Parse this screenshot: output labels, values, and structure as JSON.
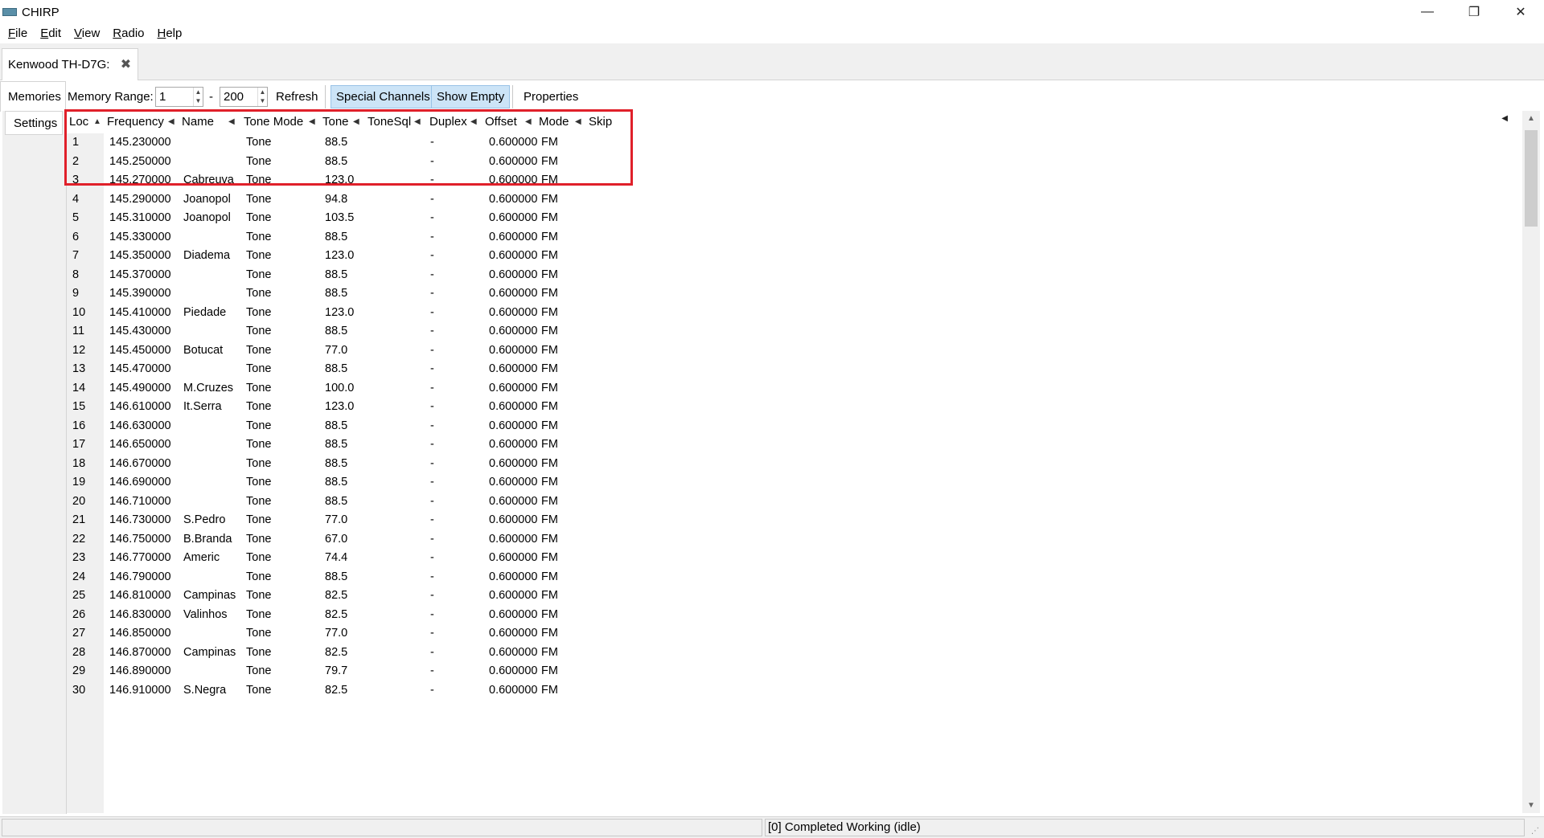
{
  "window": {
    "title": "CHIRP",
    "controls": [
      "—",
      "❐",
      "✕"
    ]
  },
  "menu": [
    {
      "label": "File",
      "accel": "F",
      "rest": "ile"
    },
    {
      "label": "Edit",
      "accel": "E",
      "rest": "dit"
    },
    {
      "label": "View",
      "accel": "V",
      "rest": "iew"
    },
    {
      "label": "Radio",
      "accel": "R",
      "rest": "adio"
    },
    {
      "label": "Help",
      "accel": "H",
      "rest": "elp"
    }
  ],
  "tab": {
    "label": "Kenwood TH-D7G:",
    "close_glyph": "✖"
  },
  "toolbar": {
    "memories": "Memories",
    "range_label": "Memory Range:",
    "range_start": "1",
    "range_dash": "-",
    "range_end": "200",
    "refresh": "Refresh",
    "special_channels": "Special Channels",
    "show_empty": "Show Empty",
    "properties": "Properties"
  },
  "settings_tab": "Settings",
  "columns": [
    "Loc",
    "Frequency",
    "Name",
    "Tone Mode",
    "Tone",
    "ToneSql",
    "Duplex",
    "Offset",
    "Mode",
    "Skip"
  ],
  "rows": [
    [
      "1",
      "145.230000",
      "",
      "Tone",
      "88.5",
      "",
      "-",
      "0.600000",
      "FM",
      ""
    ],
    [
      "2",
      "145.250000",
      "",
      "Tone",
      "88.5",
      "",
      "-",
      "0.600000",
      "FM",
      ""
    ],
    [
      "3",
      "145.270000",
      "Cabreuva",
      "Tone",
      "123.0",
      "",
      "-",
      "0.600000",
      "FM",
      ""
    ],
    [
      "4",
      "145.290000",
      "Joanopol",
      "Tone",
      "94.8",
      "",
      "-",
      "0.600000",
      "FM",
      ""
    ],
    [
      "5",
      "145.310000",
      "Joanopol",
      "Tone",
      "103.5",
      "",
      "-",
      "0.600000",
      "FM",
      ""
    ],
    [
      "6",
      "145.330000",
      "",
      "Tone",
      "88.5",
      "",
      "-",
      "0.600000",
      "FM",
      ""
    ],
    [
      "7",
      "145.350000",
      "Diadema",
      "Tone",
      "123.0",
      "",
      "-",
      "0.600000",
      "FM",
      ""
    ],
    [
      "8",
      "145.370000",
      "",
      "Tone",
      "88.5",
      "",
      "-",
      "0.600000",
      "FM",
      ""
    ],
    [
      "9",
      "145.390000",
      "",
      "Tone",
      "88.5",
      "",
      "-",
      "0.600000",
      "FM",
      ""
    ],
    [
      "10",
      "145.410000",
      "Piedade",
      "Tone",
      "123.0",
      "",
      "-",
      "0.600000",
      "FM",
      ""
    ],
    [
      "11",
      "145.430000",
      "",
      "Tone",
      "88.5",
      "",
      "-",
      "0.600000",
      "FM",
      ""
    ],
    [
      "12",
      "145.450000",
      "Botucat",
      "Tone",
      "77.0",
      "",
      "-",
      "0.600000",
      "FM",
      ""
    ],
    [
      "13",
      "145.470000",
      "",
      "Tone",
      "88.5",
      "",
      "-",
      "0.600000",
      "FM",
      ""
    ],
    [
      "14",
      "145.490000",
      "M.Cruzes",
      "Tone",
      "100.0",
      "",
      "-",
      "0.600000",
      "FM",
      ""
    ],
    [
      "15",
      "146.610000",
      "It.Serra",
      "Tone",
      "123.0",
      "",
      "-",
      "0.600000",
      "FM",
      ""
    ],
    [
      "16",
      "146.630000",
      "",
      "Tone",
      "88.5",
      "",
      "-",
      "0.600000",
      "FM",
      ""
    ],
    [
      "17",
      "146.650000",
      "",
      "Tone",
      "88.5",
      "",
      "-",
      "0.600000",
      "FM",
      ""
    ],
    [
      "18",
      "146.670000",
      "",
      "Tone",
      "88.5",
      "",
      "-",
      "0.600000",
      "FM",
      ""
    ],
    [
      "19",
      "146.690000",
      "",
      "Tone",
      "88.5",
      "",
      "-",
      "0.600000",
      "FM",
      ""
    ],
    [
      "20",
      "146.710000",
      "",
      "Tone",
      "88.5",
      "",
      "-",
      "0.600000",
      "FM",
      ""
    ],
    [
      "21",
      "146.730000",
      "S.Pedro",
      "Tone",
      "77.0",
      "",
      "-",
      "0.600000",
      "FM",
      ""
    ],
    [
      "22",
      "146.750000",
      "B.Branda",
      "Tone",
      "67.0",
      "",
      "-",
      "0.600000",
      "FM",
      ""
    ],
    [
      "23",
      "146.770000",
      "Americ",
      "Tone",
      "74.4",
      "",
      "-",
      "0.600000",
      "FM",
      ""
    ],
    [
      "24",
      "146.790000",
      "",
      "Tone",
      "88.5",
      "",
      "-",
      "0.600000",
      "FM",
      ""
    ],
    [
      "25",
      "146.810000",
      "Campinas",
      "Tone",
      "82.5",
      "",
      "-",
      "0.600000",
      "FM",
      ""
    ],
    [
      "26",
      "146.830000",
      "Valinhos",
      "Tone",
      "82.5",
      "",
      "-",
      "0.600000",
      "FM",
      ""
    ],
    [
      "27",
      "146.850000",
      "",
      "Tone",
      "77.0",
      "",
      "-",
      "0.600000",
      "FM",
      ""
    ],
    [
      "28",
      "146.870000",
      "Campinas",
      "Tone",
      "82.5",
      "",
      "-",
      "0.600000",
      "FM",
      ""
    ],
    [
      "29",
      "146.890000",
      "",
      "Tone",
      "79.7",
      "",
      "-",
      "0.600000",
      "FM",
      ""
    ],
    [
      "30",
      "146.910000",
      "S.Negra",
      "Tone",
      "82.5",
      "",
      "-",
      "0.600000",
      "FM",
      ""
    ]
  ],
  "status": {
    "message": "[0] Completed Working (idle)"
  },
  "colors": {
    "highlight": "#e0202a",
    "toggle_bg": "#cce4f7"
  },
  "icons": [
    "app-icon",
    "close-tab-icon",
    "sort-ascending-icon",
    "sort-indicator-icon",
    "scroll-up-icon",
    "scroll-down-icon",
    "resize-grip-icon"
  ]
}
